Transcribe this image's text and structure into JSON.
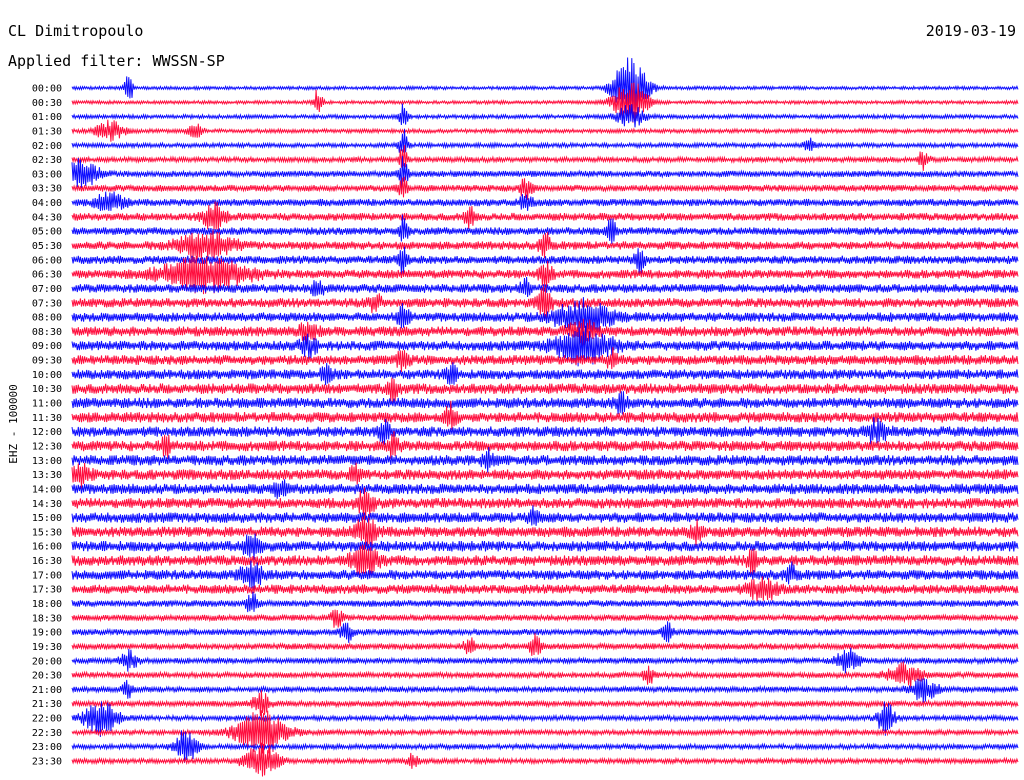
{
  "header": {
    "station": "CL Dimitropoulo",
    "filter": "Applied filter: WWSSN-SP",
    "date": "2019-03-19"
  },
  "channel_label": "EHZ - 100000",
  "colors": {
    "trace_a": "#0000ff",
    "trace_b": "#ff0033",
    "background": "#ffffff",
    "text": "#000000"
  },
  "chart_data": {
    "type": "helicorder",
    "title": "CL Dimitropoulo",
    "subtitle": "Applied filter: WWSSN-SP",
    "date": "2019-03-19",
    "ylabel": "EHZ - 100000",
    "xlabel": "",
    "grid": false,
    "trace_interval_minutes": 30,
    "color_cycle": [
      "#0000ff",
      "#ff0033"
    ],
    "rows": [
      {
        "label": "00:00",
        "color": "#0000ff",
        "noise": 0.3,
        "events": [
          {
            "pos": 0.59,
            "amp": 6.0,
            "width": 0.012
          },
          {
            "pos": 0.06,
            "amp": 3.0,
            "width": 0.003
          }
        ]
      },
      {
        "label": "00:30",
        "color": "#ff0033",
        "noise": 0.3,
        "events": [
          {
            "pos": 0.59,
            "amp": 4.0,
            "width": 0.012
          },
          {
            "pos": 0.26,
            "amp": 2.5,
            "width": 0.003
          }
        ]
      },
      {
        "label": "01:00",
        "color": "#0000ff",
        "noise": 0.35,
        "events": [
          {
            "pos": 0.59,
            "amp": 2.0,
            "width": 0.01
          },
          {
            "pos": 0.35,
            "amp": 2.2,
            "width": 0.003
          }
        ]
      },
      {
        "label": "01:30",
        "color": "#ff0033",
        "noise": 0.35,
        "events": [
          {
            "pos": 0.04,
            "amp": 1.8,
            "width": 0.01
          },
          {
            "pos": 0.13,
            "amp": 1.5,
            "width": 0.005
          }
        ]
      },
      {
        "label": "02:00",
        "color": "#0000ff",
        "noise": 0.4,
        "events": [
          {
            "pos": 0.35,
            "amp": 3.0,
            "width": 0.003
          },
          {
            "pos": 0.78,
            "amp": 1.6,
            "width": 0.004
          }
        ]
      },
      {
        "label": "02:30",
        "color": "#ff0033",
        "noise": 0.45,
        "events": [
          {
            "pos": 0.35,
            "amp": 2.5,
            "width": 0.003
          },
          {
            "pos": 0.9,
            "amp": 1.6,
            "width": 0.004
          }
        ]
      },
      {
        "label": "03:00",
        "color": "#0000ff",
        "noise": 0.55,
        "events": [
          {
            "pos": 0.01,
            "amp": 2.5,
            "width": 0.012
          },
          {
            "pos": 0.35,
            "amp": 3.0,
            "width": 0.003
          }
        ]
      },
      {
        "label": "03:30",
        "color": "#ff0033",
        "noise": 0.6,
        "events": [
          {
            "pos": 0.48,
            "amp": 2.0,
            "width": 0.004
          },
          {
            "pos": 0.35,
            "amp": 2.5,
            "width": 0.003
          }
        ]
      },
      {
        "label": "04:00",
        "color": "#0000ff",
        "noise": 0.65,
        "events": [
          {
            "pos": 0.04,
            "amp": 1.8,
            "width": 0.01
          },
          {
            "pos": 0.48,
            "amp": 1.8,
            "width": 0.004
          }
        ]
      },
      {
        "label": "04:30",
        "color": "#ff0033",
        "noise": 0.7,
        "events": [
          {
            "pos": 0.15,
            "amp": 2.2,
            "width": 0.008
          },
          {
            "pos": 0.42,
            "amp": 1.8,
            "width": 0.004
          }
        ]
      },
      {
        "label": "05:00",
        "color": "#0000ff",
        "noise": 0.7,
        "events": [
          {
            "pos": 0.35,
            "amp": 2.5,
            "width": 0.003
          },
          {
            "pos": 0.57,
            "amp": 1.8,
            "width": 0.004
          }
        ]
      },
      {
        "label": "05:30",
        "color": "#ff0033",
        "noise": 0.75,
        "events": [
          {
            "pos": 0.14,
            "amp": 2.5,
            "width": 0.02
          },
          {
            "pos": 0.5,
            "amp": 2.2,
            "width": 0.004
          }
        ]
      },
      {
        "label": "06:00",
        "color": "#0000ff",
        "noise": 0.75,
        "events": [
          {
            "pos": 0.35,
            "amp": 2.5,
            "width": 0.004
          },
          {
            "pos": 0.6,
            "amp": 2.0,
            "width": 0.004
          }
        ]
      },
      {
        "label": "06:30",
        "color": "#ff0033",
        "noise": 0.8,
        "events": [
          {
            "pos": 0.14,
            "amp": 3.0,
            "width": 0.03
          },
          {
            "pos": 0.5,
            "amp": 2.0,
            "width": 0.005
          }
        ]
      },
      {
        "label": "07:00",
        "color": "#0000ff",
        "noise": 0.8,
        "events": [
          {
            "pos": 0.26,
            "amp": 1.8,
            "width": 0.004
          },
          {
            "pos": 0.48,
            "amp": 1.6,
            "width": 0.004
          }
        ]
      },
      {
        "label": "07:30",
        "color": "#ff0033",
        "noise": 0.85,
        "events": [
          {
            "pos": 0.5,
            "amp": 2.5,
            "width": 0.005
          },
          {
            "pos": 0.32,
            "amp": 2.0,
            "width": 0.004
          }
        ]
      },
      {
        "label": "08:00",
        "color": "#0000ff",
        "noise": 0.85,
        "events": [
          {
            "pos": 0.54,
            "amp": 2.8,
            "width": 0.02
          },
          {
            "pos": 0.35,
            "amp": 1.8,
            "width": 0.004
          }
        ]
      },
      {
        "label": "08:30",
        "color": "#ff0033",
        "noise": 0.9,
        "events": [
          {
            "pos": 0.25,
            "amp": 2.0,
            "width": 0.006
          },
          {
            "pos": 0.54,
            "amp": 1.8,
            "width": 0.01
          }
        ]
      },
      {
        "label": "09:00",
        "color": "#0000ff",
        "noise": 0.9,
        "events": [
          {
            "pos": 0.54,
            "amp": 3.0,
            "width": 0.02
          },
          {
            "pos": 0.25,
            "amp": 1.6,
            "width": 0.006
          }
        ]
      },
      {
        "label": "09:30",
        "color": "#ff0033",
        "noise": 0.9,
        "events": [
          {
            "pos": 0.35,
            "amp": 1.8,
            "width": 0.004
          },
          {
            "pos": 0.57,
            "amp": 1.6,
            "width": 0.004
          }
        ]
      },
      {
        "label": "10:00",
        "color": "#0000ff",
        "noise": 0.9,
        "events": [
          {
            "pos": 0.27,
            "amp": 1.8,
            "width": 0.004
          },
          {
            "pos": 0.4,
            "amp": 1.8,
            "width": 0.004
          }
        ]
      },
      {
        "label": "10:30",
        "color": "#ff0033",
        "noise": 0.95,
        "events": [
          {
            "pos": 0.34,
            "amp": 2.0,
            "width": 0.004
          }
        ]
      },
      {
        "label": "11:00",
        "color": "#0000ff",
        "noise": 0.95,
        "events": [
          {
            "pos": 0.58,
            "amp": 1.8,
            "width": 0.004
          }
        ]
      },
      {
        "label": "11:30",
        "color": "#ff0033",
        "noise": 0.95,
        "events": [
          {
            "pos": 0.4,
            "amp": 2.2,
            "width": 0.004
          }
        ]
      },
      {
        "label": "12:00",
        "color": "#0000ff",
        "noise": 0.95,
        "events": [
          {
            "pos": 0.33,
            "amp": 1.8,
            "width": 0.004
          },
          {
            "pos": 0.85,
            "amp": 1.8,
            "width": 0.008
          }
        ]
      },
      {
        "label": "12:30",
        "color": "#ff0033",
        "noise": 0.95,
        "events": [
          {
            "pos": 0.34,
            "amp": 1.8,
            "width": 0.004
          },
          {
            "pos": 0.1,
            "amp": 1.6,
            "width": 0.004
          }
        ]
      },
      {
        "label": "13:00",
        "color": "#0000ff",
        "noise": 0.95,
        "events": [
          {
            "pos": 0.44,
            "amp": 1.6,
            "width": 0.004
          }
        ]
      },
      {
        "label": "13:30",
        "color": "#ff0033",
        "noise": 0.95,
        "events": [
          {
            "pos": 0.01,
            "amp": 2.0,
            "width": 0.006
          },
          {
            "pos": 0.3,
            "amp": 1.8,
            "width": 0.004
          }
        ]
      },
      {
        "label": "14:00",
        "color": "#0000ff",
        "noise": 0.95,
        "events": [
          {
            "pos": 0.22,
            "amp": 1.6,
            "width": 0.004
          }
        ]
      },
      {
        "label": "14:30",
        "color": "#ff0033",
        "noise": 0.95,
        "events": [
          {
            "pos": 0.31,
            "amp": 2.2,
            "width": 0.006
          }
        ]
      },
      {
        "label": "15:00",
        "color": "#0000ff",
        "noise": 0.95,
        "events": [
          {
            "pos": 0.49,
            "amp": 1.8,
            "width": 0.004
          }
        ]
      },
      {
        "label": "15:30",
        "color": "#ff0033",
        "noise": 0.95,
        "events": [
          {
            "pos": 0.31,
            "amp": 2.5,
            "width": 0.008
          },
          {
            "pos": 0.66,
            "amp": 1.8,
            "width": 0.004
          }
        ]
      },
      {
        "label": "16:00",
        "color": "#0000ff",
        "noise": 0.95,
        "events": [
          {
            "pos": 0.19,
            "amp": 1.8,
            "width": 0.006
          }
        ]
      },
      {
        "label": "16:30",
        "color": "#ff0033",
        "noise": 0.95,
        "events": [
          {
            "pos": 0.31,
            "amp": 2.5,
            "width": 0.01
          },
          {
            "pos": 0.72,
            "amp": 2.0,
            "width": 0.004
          }
        ]
      },
      {
        "label": "17:00",
        "color": "#0000ff",
        "noise": 0.9,
        "events": [
          {
            "pos": 0.19,
            "amp": 2.0,
            "width": 0.008
          },
          {
            "pos": 0.76,
            "amp": 1.6,
            "width": 0.004
          }
        ]
      },
      {
        "label": "17:30",
        "color": "#ff0033",
        "noise": 0.85,
        "events": [
          {
            "pos": 0.73,
            "amp": 2.0,
            "width": 0.01
          }
        ]
      },
      {
        "label": "18:00",
        "color": "#0000ff",
        "noise": 0.6,
        "events": [
          {
            "pos": 0.19,
            "amp": 1.8,
            "width": 0.004
          }
        ]
      },
      {
        "label": "18:30",
        "color": "#ff0033",
        "noise": 0.55,
        "events": [
          {
            "pos": 0.28,
            "amp": 1.8,
            "width": 0.004
          }
        ]
      },
      {
        "label": "19:00",
        "color": "#0000ff",
        "noise": 0.55,
        "events": [
          {
            "pos": 0.29,
            "amp": 2.0,
            "width": 0.004
          },
          {
            "pos": 0.63,
            "amp": 1.6,
            "width": 0.004
          }
        ]
      },
      {
        "label": "19:30",
        "color": "#ff0033",
        "noise": 0.55,
        "events": [
          {
            "pos": 0.49,
            "amp": 2.0,
            "width": 0.004
          },
          {
            "pos": 0.42,
            "amp": 1.5,
            "width": 0.004
          }
        ]
      },
      {
        "label": "20:00",
        "color": "#0000ff",
        "noise": 0.5,
        "events": [
          {
            "pos": 0.06,
            "amp": 2.0,
            "width": 0.006
          },
          {
            "pos": 0.82,
            "amp": 2.2,
            "width": 0.008
          }
        ]
      },
      {
        "label": "20:30",
        "color": "#ff0033",
        "noise": 0.5,
        "events": [
          {
            "pos": 0.88,
            "amp": 2.2,
            "width": 0.012
          },
          {
            "pos": 0.61,
            "amp": 1.6,
            "width": 0.004
          }
        ]
      },
      {
        "label": "21:00",
        "color": "#0000ff",
        "noise": 0.5,
        "events": [
          {
            "pos": 0.9,
            "amp": 2.0,
            "width": 0.01
          },
          {
            "pos": 0.06,
            "amp": 1.6,
            "width": 0.004
          }
        ]
      },
      {
        "label": "21:30",
        "color": "#ff0033",
        "noise": 0.5,
        "events": [
          {
            "pos": 0.2,
            "amp": 2.0,
            "width": 0.006
          }
        ]
      },
      {
        "label": "22:00",
        "color": "#0000ff",
        "noise": 0.45,
        "events": [
          {
            "pos": 0.03,
            "amp": 3.0,
            "width": 0.012
          },
          {
            "pos": 0.86,
            "amp": 3.0,
            "width": 0.006
          }
        ]
      },
      {
        "label": "22:30",
        "color": "#ff0033",
        "noise": 0.45,
        "events": [
          {
            "pos": 0.2,
            "amp": 4.0,
            "width": 0.018
          }
        ]
      },
      {
        "label": "23:00",
        "color": "#0000ff",
        "noise": 0.45,
        "events": [
          {
            "pos": 0.12,
            "amp": 3.0,
            "width": 0.008
          }
        ]
      },
      {
        "label": "23:30",
        "color": "#ff0033",
        "noise": 0.45,
        "events": [
          {
            "pos": 0.2,
            "amp": 3.0,
            "width": 0.012
          },
          {
            "pos": 0.36,
            "amp": 1.5,
            "width": 0.004
          }
        ]
      }
    ]
  }
}
